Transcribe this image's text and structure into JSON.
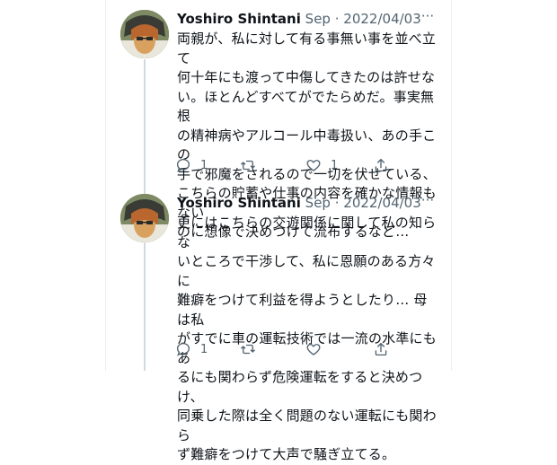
{
  "tweets": [
    {
      "name": "Yoshiro Shintani",
      "handle": "Sep",
      "separator": "·",
      "date": "2022/04/03",
      "more": "···",
      "lines": [
        "両親が、私に対して有る事無い事を並べ立て",
        "何十年にも渡って中傷してきたのは許せな",
        "い。ほとんどすべてがでたらめだ。事実無根",
        "の精神病やアルコール中毒扱い、あの手この",
        "手で邪魔をされるので一切を伏せている、",
        "こちらの貯蓄や仕事の内容を確かな情報もない",
        "のに想像で決めつけて流布するなど…"
      ],
      "actions": {
        "reply_icon": "reply-icon",
        "reply_count": "1",
        "retweet_icon": "retweet-icon",
        "retweet_count": "",
        "like_icon": "heart-icon",
        "like_count": "1",
        "share_icon": "share-icon"
      }
    },
    {
      "name": "Yoshiro Shintani",
      "handle": "Sep",
      "separator": "·",
      "date": "2022/04/03",
      "more": "···",
      "lines": [
        "更にはこちらの交遊関係に関して私の知らな",
        "いところで干渉して、私に恩願のある方々に",
        "難癖をつけて利益を得ようとしたり… 母は私",
        "がすでに車の運転技術では一流の水準にもあ",
        "るにも関わらず危険運転をすると決めつけ、",
        "同乗した際は全く問題のない運転にも関わら",
        "ず難癖をつけて大声で騒ぎ立てる。"
      ],
      "actions": {
        "reply_icon": "reply-icon",
        "reply_count": "1",
        "retweet_icon": "retweet-icon",
        "retweet_count": "",
        "like_icon": "heart-icon",
        "like_count": "",
        "share_icon": "share-icon"
      }
    }
  ],
  "colors": {
    "text": "#0f1419",
    "secondary": "#536471",
    "thread_line": "#cfd9de",
    "background": "#ffffff"
  }
}
